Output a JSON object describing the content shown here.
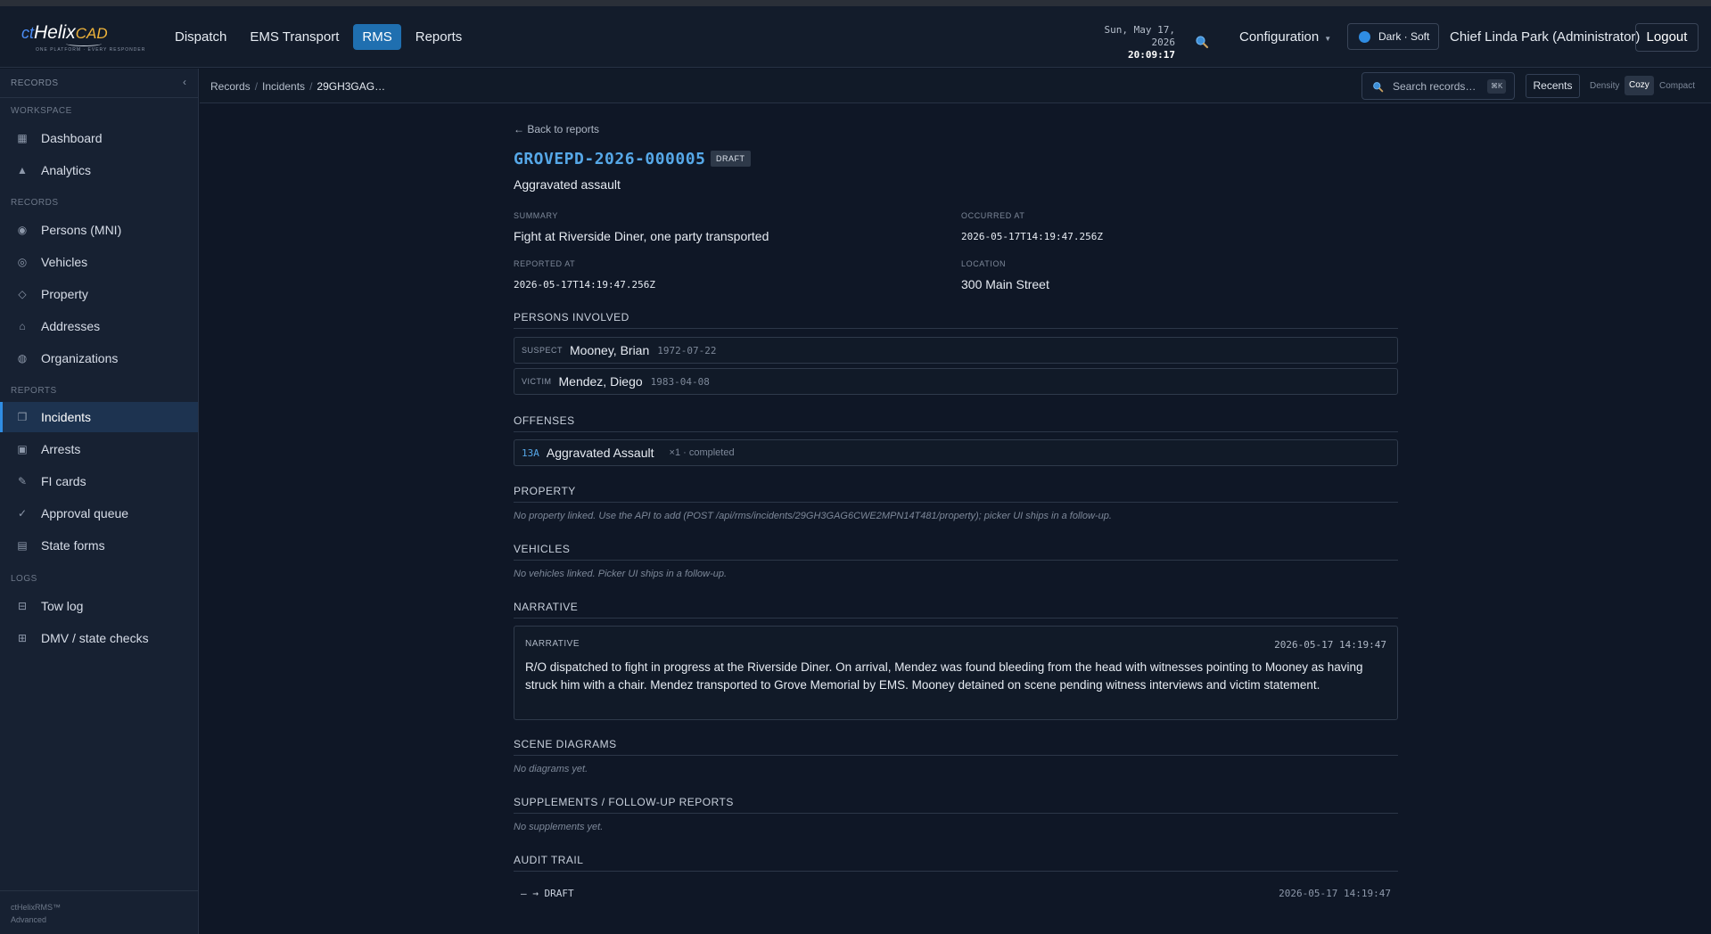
{
  "app": {
    "logo_ct": "ct",
    "logo_helix": "Helix",
    "logo_cad": "CAD",
    "logo_tagline": "ONE PLATFORM · EVERY RESPONDER"
  },
  "nav": [
    {
      "label": "Dispatch"
    },
    {
      "label": "EMS Transport"
    },
    {
      "label": "RMS",
      "active": true
    },
    {
      "label": "Reports"
    }
  ],
  "header": {
    "date": "Sun, May 17, 2026",
    "time": "20:09:17",
    "configuration": "Configuration",
    "theme": "Dark · Soft",
    "user": "Chief Linda Park (Administrator)",
    "logout": "Logout"
  },
  "sidebar": {
    "title": "RECORDS",
    "sections": [
      {
        "title": "WORKSPACE",
        "items": [
          {
            "label": "Dashboard",
            "icon": "grid-icon"
          },
          {
            "label": "Analytics",
            "icon": "triangle-icon"
          }
        ]
      },
      {
        "title": "RECORDS",
        "items": [
          {
            "label": "Persons (MNI)",
            "icon": "radio-icon"
          },
          {
            "label": "Vehicles",
            "icon": "ring-icon"
          },
          {
            "label": "Property",
            "icon": "diamond-icon"
          },
          {
            "label": "Addresses",
            "icon": "house-icon"
          },
          {
            "label": "Organizations",
            "icon": "globe-icon"
          }
        ]
      },
      {
        "title": "REPORTS",
        "items": [
          {
            "label": "Incidents",
            "icon": "copy-icon",
            "active": true
          },
          {
            "label": "Arrests",
            "icon": "square-icon"
          },
          {
            "label": "FI cards",
            "icon": "pencil-icon"
          },
          {
            "label": "Approval queue",
            "icon": "check-icon"
          },
          {
            "label": "State forms",
            "icon": "form-icon"
          }
        ]
      },
      {
        "title": "LOGS",
        "items": [
          {
            "label": "Tow log",
            "icon": "log-icon"
          },
          {
            "label": "DMV / state checks",
            "icon": "table-icon"
          }
        ]
      }
    ],
    "footer_product": "ctHelixRMS™",
    "footer_tier": "Advanced"
  },
  "toolbar": {
    "breadcrumbs": [
      "Records",
      "Incidents",
      "29GH3GAG…"
    ],
    "search_placeholder": "Search records…",
    "search_shortcut": "⌘K",
    "recents": "Recents",
    "density_label": "Density",
    "density_cozy": "Cozy",
    "density_compact": "Compact"
  },
  "report": {
    "back": "← Back to reports",
    "id": "GROVEPD-2026-000005",
    "status": "DRAFT",
    "title": "Aggravated assault",
    "fields": {
      "summary_label": "SUMMARY",
      "summary": "Fight at Riverside Diner, one party transported",
      "occurred_label": "OCCURRED AT",
      "occurred": "2026-05-17T14:19:47.256Z",
      "reported_label": "REPORTED AT",
      "reported": "2026-05-17T14:19:47.256Z",
      "location_label": "LOCATION",
      "location": "300 Main Street"
    },
    "persons_heading": "PERSONS INVOLVED",
    "persons": [
      {
        "role": "SUSPECT",
        "name": "Mooney, Brian",
        "dob": "1972-07-22"
      },
      {
        "role": "VICTIM",
        "name": "Mendez, Diego",
        "dob": "1983-04-08"
      }
    ],
    "offenses_heading": "OFFENSES",
    "offenses": [
      {
        "code": "13A",
        "name": "Aggravated Assault",
        "meta": "×1 · completed"
      }
    ],
    "property_heading": "PROPERTY",
    "property_empty": "No property linked. Use the API to add (POST /api/rms/incidents/29GH3GAG6CWE2MPN14T481/property); picker UI ships in a follow-up.",
    "vehicles_heading": "VEHICLES",
    "vehicles_empty": "No vehicles linked. Picker UI ships in a follow-up.",
    "narrative_heading": "NARRATIVE",
    "narrative": {
      "label": "NARRATIVE",
      "timestamp": "2026-05-17 14:19:47",
      "text": "R/O dispatched to fight in progress at the Riverside Diner. On arrival, Mendez was found bleeding from the head with witnesses pointing to Mooney as having struck him with a chair. Mendez transported to Grove Memorial by EMS. Mooney detained on scene pending witness interviews and victim statement."
    },
    "diagrams_heading": "SCENE DIAGRAMS",
    "diagrams_empty": "No diagrams yet.",
    "supplements_heading": "SUPPLEMENTS / FOLLOW-UP REPORTS",
    "supplements_empty": "No supplements yet.",
    "audit_heading": "AUDIT TRAIL",
    "audit": [
      {
        "transition": "— → DRAFT",
        "timestamp": "2026-05-17 14:19:47"
      }
    ]
  },
  "colors": {
    "accent": "#2f8de4",
    "link": "#56a8e8",
    "background": "#0f1726"
  }
}
